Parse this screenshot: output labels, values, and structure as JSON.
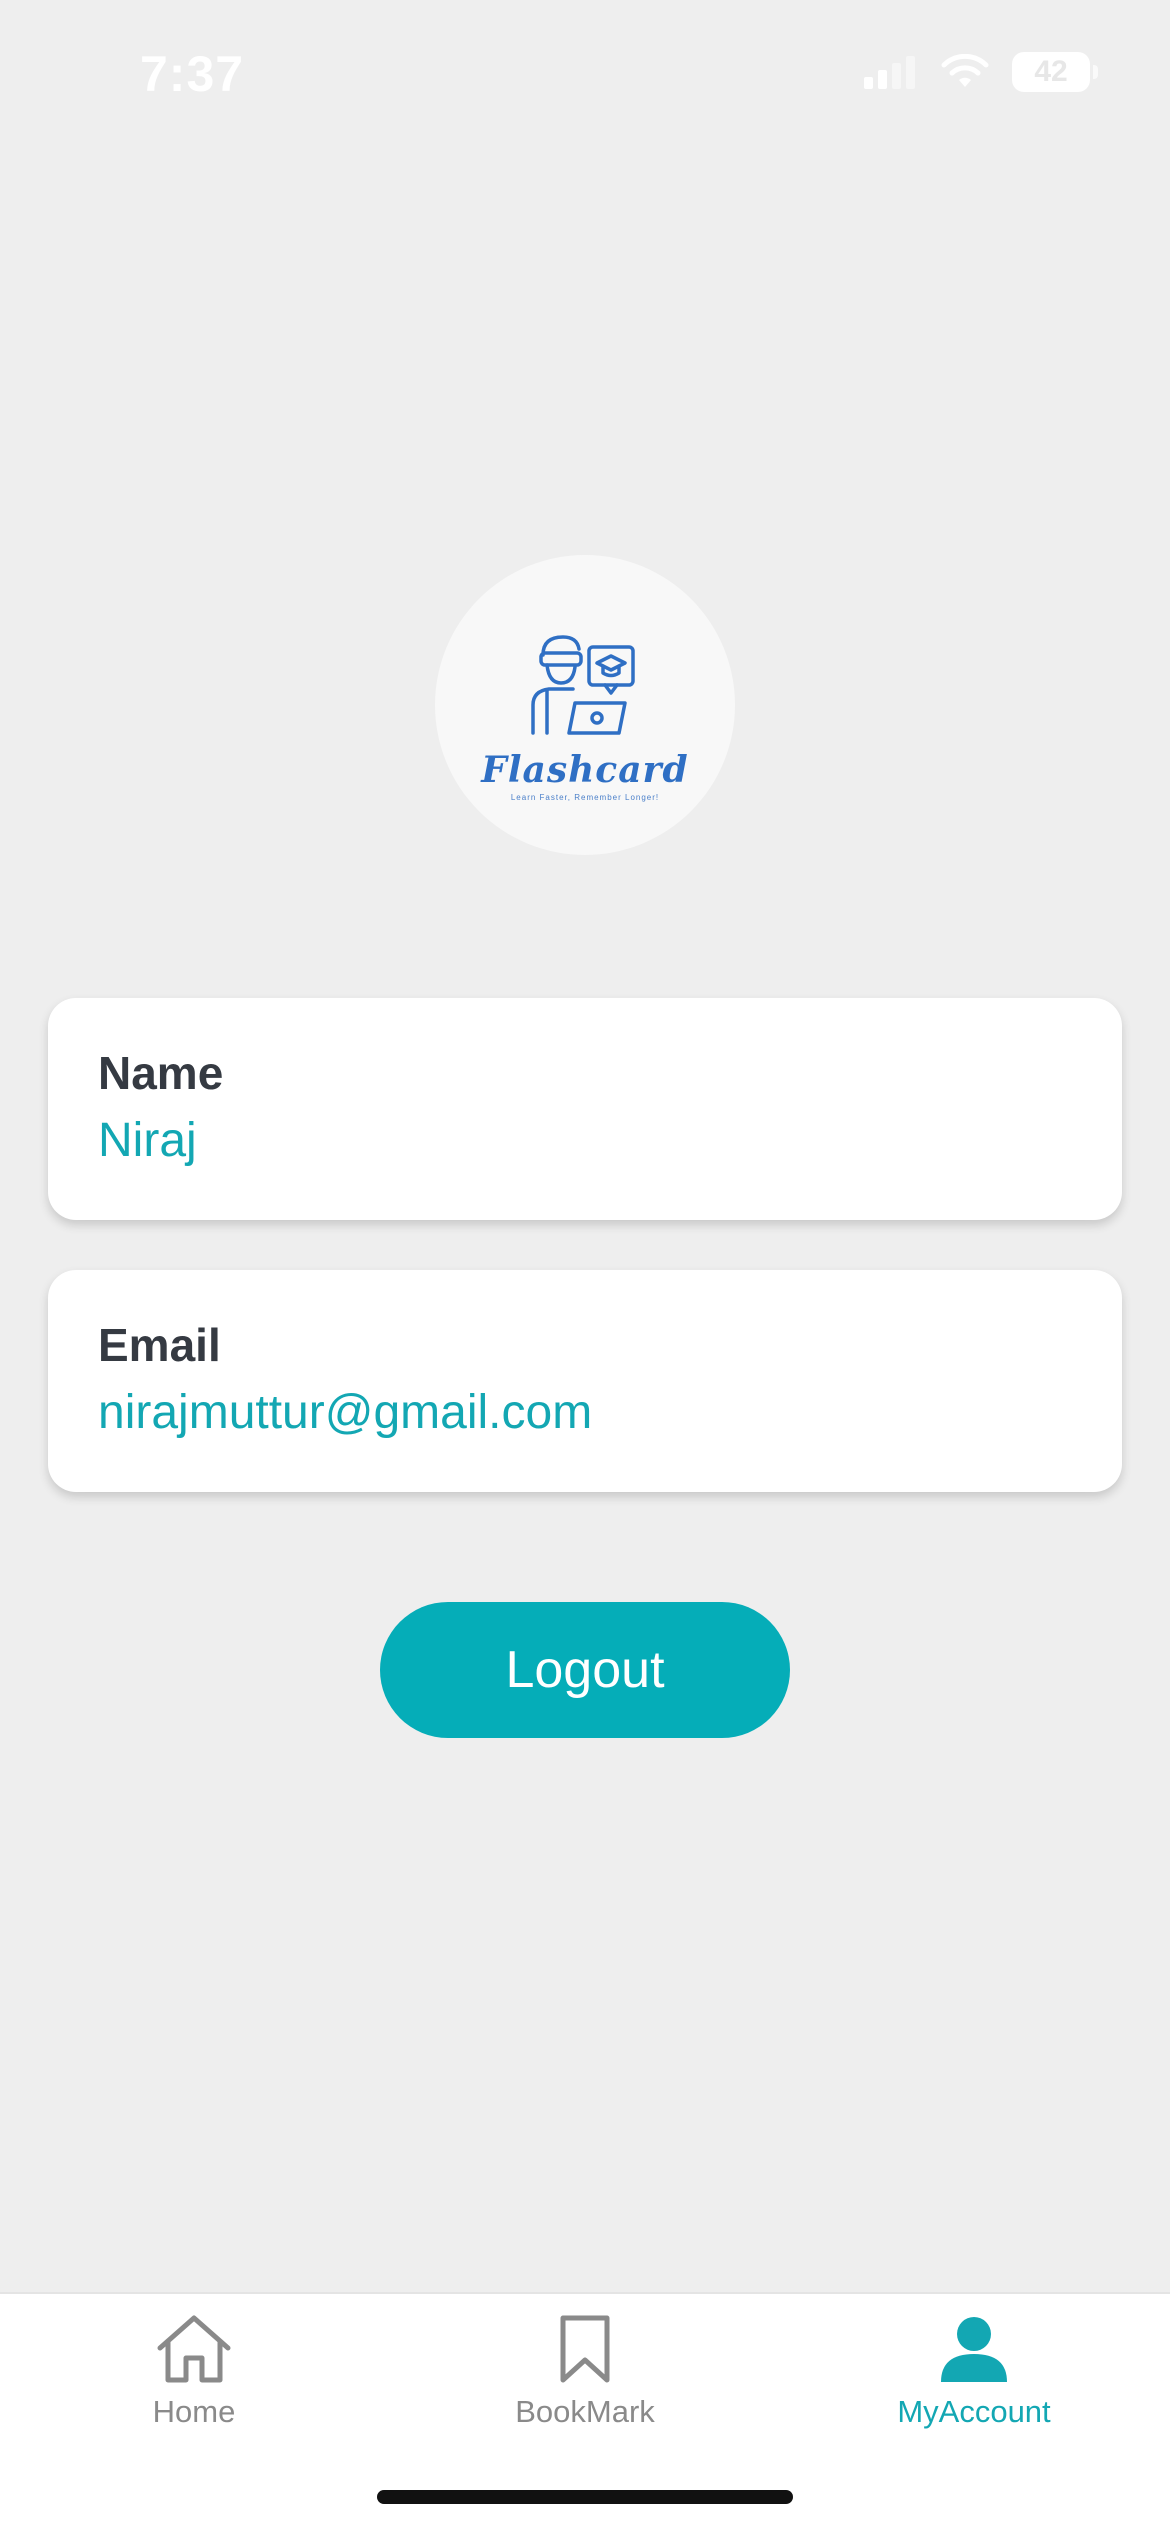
{
  "status_bar": {
    "time": "7:37",
    "battery_level": "42",
    "icons": [
      "signal-icon",
      "wifi-icon",
      "battery-icon"
    ]
  },
  "logo": {
    "title": "Flashcard",
    "tagline": "Learn Faster, Remember Longer!",
    "icon": "student-laptop-icon",
    "color": "#2f6fc4"
  },
  "profile": {
    "name_label": "Name",
    "name_value": "Niraj",
    "email_label": "Email",
    "email_value": "nirajmuttur@gmail.com"
  },
  "actions": {
    "logout_label": "Logout"
  },
  "tab_bar": {
    "active": "MyAccount",
    "tabs": [
      {
        "label": "Home",
        "icon": "home-icon"
      },
      {
        "label": "BookMark",
        "icon": "bookmark-icon"
      },
      {
        "label": "MyAccount",
        "icon": "user-icon"
      }
    ]
  },
  "colors": {
    "accent": "#05adb8",
    "background": "#eeeeee",
    "text_dark": "#353a42",
    "inactive": "#8a8a8a"
  }
}
